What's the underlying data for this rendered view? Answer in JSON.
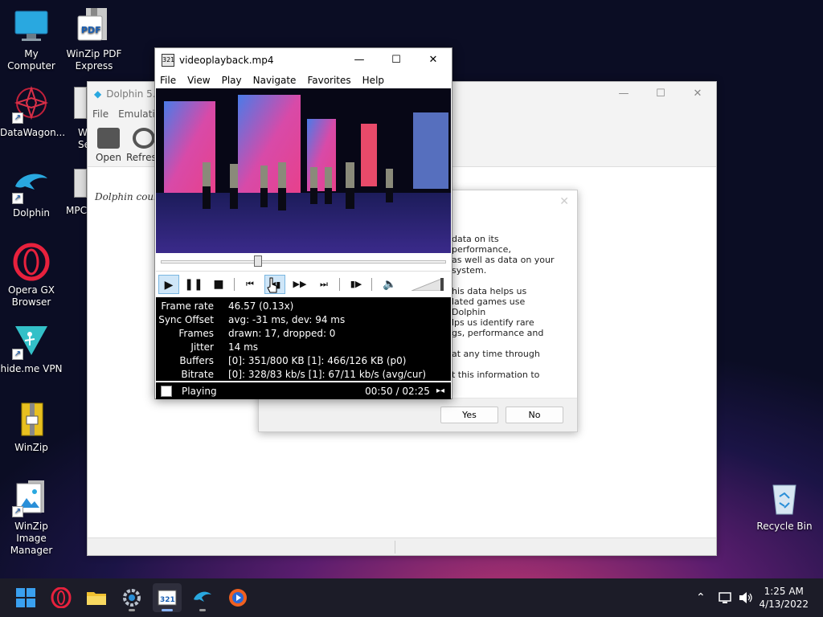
{
  "desktop": {
    "icons": [
      {
        "label": "My Computer",
        "icon": "computer-icon"
      },
      {
        "label": "WinZip PDF Express",
        "icon": "pdf-icon"
      },
      {
        "label": "DataWagon...",
        "icon": "datawagon-icon"
      },
      {
        "label": "Dolphin",
        "icon": "dolphin-icon"
      },
      {
        "label": "Opera GX Browser",
        "icon": "opera-icon"
      },
      {
        "label": "hide.me VPN",
        "icon": "vpn-icon"
      },
      {
        "label": "WinZip",
        "icon": "winzip-icon"
      },
      {
        "label": "WinZip Image Manager",
        "icon": "image-manager-icon"
      },
      {
        "label": "Recycle Bin",
        "icon": "recycle-bin-icon"
      }
    ],
    "partial_labels": {
      "we": "W",
      "se": "Se",
      "mpc": "MPC"
    }
  },
  "dolphin_window": {
    "title": "Dolphin 5.",
    "menu": [
      "File",
      "Emulatio"
    ],
    "toolbar": [
      {
        "label": "Open"
      },
      {
        "label": "Refresh"
      }
    ],
    "hint_text": "Dolphin could n"
  },
  "dialog": {
    "paragraphs": [
      [
        "data on its performance,",
        "as well as data on your",
        "system."
      ],
      [
        "his data helps us",
        "lated games use Dolphin",
        "lps us identify rare",
        "gs, performance and"
      ],
      [
        "at any time through"
      ],
      [
        "t this information to"
      ]
    ],
    "yes_label": "Yes",
    "no_label": "No"
  },
  "mpc": {
    "title": "videoplayback.mp4",
    "menu": [
      "File",
      "View",
      "Play",
      "Navigate",
      "Favorites",
      "Help"
    ],
    "seek_position_fraction": 0.34,
    "stats": [
      {
        "key": "Frame rate",
        "value": "46.57 (0.13x)"
      },
      {
        "key": "Sync Offset",
        "value": "avg: -31 ms, dev: 94 ms"
      },
      {
        "key": "Frames",
        "value": "drawn: 17, dropped: 0"
      },
      {
        "key": "Jitter",
        "value": "14 ms"
      },
      {
        "key": "Buffers",
        "value": "[0]: 351/800 KB [1]: 466/126 KB (p0)"
      },
      {
        "key": "Bitrate",
        "value": "[0]: 328/83 kb/s [1]: 67/11 kb/s (avg/cur)"
      }
    ],
    "status_text": "Playing",
    "time_text": "00:50 / 02:25"
  },
  "taskbar": {
    "apps": [
      "start-icon",
      "opera-icon",
      "file-explorer-icon",
      "settings-icon",
      "mpc-icon",
      "dolphin-icon",
      "media-player-icon"
    ],
    "clock_time": "1:25 AM",
    "clock_date": "4/13/2022"
  }
}
